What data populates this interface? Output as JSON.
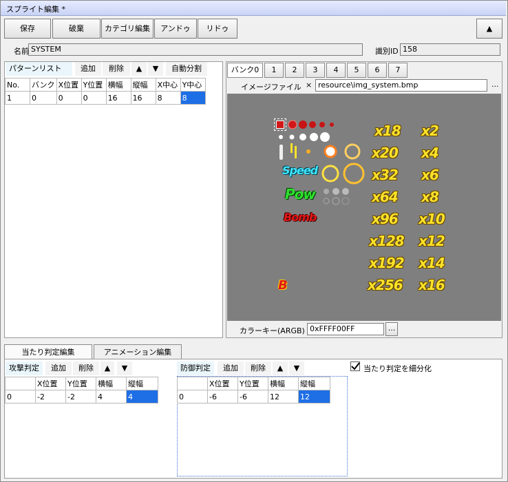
{
  "window": {
    "title": "スプライト編集 *"
  },
  "toolbar": {
    "save": "保存",
    "discard": "破棄",
    "category_edit": "カテゴリ編集",
    "undo": "アンドゥ",
    "redo": "リドゥ",
    "collapse": "▲"
  },
  "info": {
    "name_label": "名前",
    "name_value": "SYSTEM",
    "id_label": "識別ID",
    "id_value": "158"
  },
  "pattern": {
    "tab": "パターンリスト",
    "add": "追加",
    "delete": "削除",
    "up": "▲",
    "down": "▼",
    "auto_split": "自動分割",
    "columns": [
      "No.",
      "バンク",
      "X位置",
      "Y位置",
      "横幅",
      "縦幅",
      "X中心",
      "Y中心"
    ],
    "rows": [
      [
        "1",
        "0",
        "0",
        "0",
        "16",
        "16",
        "8",
        "8"
      ]
    ]
  },
  "banks": {
    "tabs": [
      "バンク0",
      "1",
      "2",
      "3",
      "4",
      "5",
      "6",
      "7"
    ],
    "image_file_label": "イメージファイル",
    "clear": "×",
    "image_path": "resource\\img_system.bmp",
    "browse": "...",
    "colorkey_label": "カラーキー(ARGB)",
    "colorkey_value": "0xFFFF00FF",
    "colorkey_browse": "..."
  },
  "sprite_sheet": {
    "labels": [
      "Speed",
      "Pow",
      "Bomb",
      "B"
    ],
    "multipliers": [
      "x18",
      "x2",
      "x20",
      "x4",
      "x32",
      "x6",
      "x64",
      "x8",
      "x96",
      "x10",
      "x128",
      "x12",
      "x192",
      "x14",
      "x256",
      "x16"
    ]
  },
  "bottom_tabs": [
    "当たり判定編集",
    "アニメーション編集"
  ],
  "attack": {
    "tab": "攻撃判定",
    "add": "追加",
    "delete": "削除",
    "up": "▲",
    "down": "▼",
    "columns": [
      "",
      "X位置",
      "Y位置",
      "横幅",
      "縦幅"
    ],
    "rows": [
      [
        "0",
        "-2",
        "-2",
        "4",
        "4"
      ]
    ]
  },
  "defense": {
    "tab": "防御判定",
    "add": "追加",
    "delete": "削除",
    "up": "▲",
    "down": "▼",
    "columns": [
      "",
      "X位置",
      "Y位置",
      "横幅",
      "縦幅"
    ],
    "rows": [
      [
        "0",
        "-6",
        "-6",
        "12",
        "12"
      ]
    ]
  },
  "subdivide": {
    "label": "当たり判定を細分化",
    "checked": true
  },
  "colors": {
    "selection": "#1e6fe6",
    "canvas": "#7f7f7f",
    "title_bar": "#c9d3f5"
  }
}
